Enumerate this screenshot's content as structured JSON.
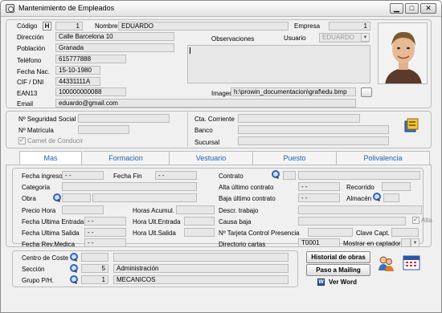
{
  "window": {
    "title": "Mantenimiento de Empleados",
    "btn_min": "▁",
    "btn_max": "□",
    "btn_close": "✕"
  },
  "employee": {
    "codigo_label": "Código",
    "codigo_h": "H",
    "codigo": "1",
    "nombre_label": "Nombre",
    "nombre": "EDUARDO",
    "empresa_label": "Empresa",
    "empresa": "1",
    "direccion_label": "Dirección",
    "direccion": "Calle Barcelona 10",
    "observaciones_label": "Observaciones",
    "usuario_label": "Usuario",
    "usuario": "EDUARDO",
    "poblacion_label": "Población",
    "poblacion": "Granada",
    "telefono_label": "Teléfono",
    "telefono": "615777888",
    "fecha_nac_label": "Fecha Nac.",
    "fecha_nac": "15-10-1980",
    "cif_label": "CIF / DNI",
    "cif": "44331111A",
    "ean_label": "EAN13",
    "ean": "100000000088",
    "imagen_label": "Imagen",
    "imagen": "h:\\prowin_documentacion\\graf\\edu.bmp",
    "email_label": "Email",
    "email": "eduardo@gmail.com"
  },
  "social": {
    "nss_label": "Nº Seguridad Social",
    "matricula_label": "Nº Matrícula",
    "carnet_label": "Carnet de Conducir",
    "cta_label": "Cta. Corriente",
    "banco_label": "Banco",
    "sucursal_label": "Sucursal"
  },
  "tabs": [
    {
      "label": "Mas"
    },
    {
      "label": "Formacion"
    },
    {
      "label": "Vestuario"
    },
    {
      "label": "Puesto"
    },
    {
      "label": "Polivalencia"
    }
  ],
  "mas": {
    "fecha_ingreso_label": "Fecha ingreso",
    "fecha_ingreso": "- -",
    "fecha_fin_label": "Fecha Fin",
    "fecha_fin": "- -",
    "contrato_label": "Contrato",
    "categoria_label": "Categoría",
    "alta_contrato_label": "Alta último contrato",
    "alta_contrato": "- -",
    "recorrido_label": "Recorrido",
    "obra_label": "Obra",
    "baja_contrato_label": "Baja último contrato",
    "baja_contrato": "- -",
    "almacen_label": "Almacén",
    "precio_hora_label": "Precio Hora",
    "horas_acumul_label": "Horas Acumul.",
    "descr_trabajo_label": "Descr. trabajo",
    "fecha_ultima_entrada_label": "Fecha Ultima Entrada",
    "fecha_ultima_entrada": "- -",
    "hora_ult_entrada_label": "Hora Ult.Entrada",
    "causa_baja_label": "Causa baja",
    "alta_label": "Alta",
    "fecha_ultima_salida_label": "Fecha Ultima Salida",
    "fecha_ultima_salida": "- -",
    "hora_ult_salida_label": "Hora Ult.Salida",
    "tarjeta_label": "Nº Tarjeta Control Presencia",
    "clave_capt_label": "Clave Capt.",
    "fecha_rev_medica_label": "Fecha Rev.Medica",
    "fecha_rev_medica": "- -",
    "directorio_label": "Directorio cartas",
    "directorio": "T0001",
    "mostrar_captador_label": "Mostrar en captador"
  },
  "bottom": {
    "centro_coste_label": "Centro de Coste",
    "seccion_label": "Sección",
    "seccion_code": "5",
    "seccion_name": "Administración",
    "grupo_label": "Grupo P/H.",
    "grupo_code": "1",
    "grupo_name": "MECANICOS",
    "btn_historial": "Historial de obras",
    "btn_mailing": "Paso a Mailing",
    "ver_word": "Ver Word"
  }
}
